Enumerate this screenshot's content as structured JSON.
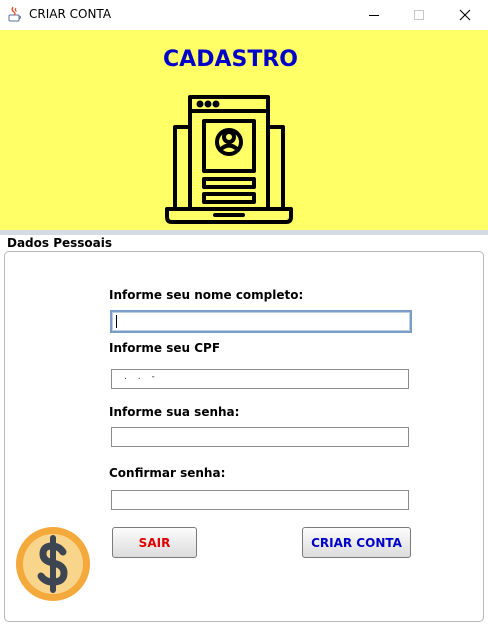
{
  "window": {
    "title": "CRIAR CONTA",
    "icons": [
      "java-cup-icon",
      "minimize-icon",
      "maximize-icon",
      "close-icon"
    ]
  },
  "banner": {
    "title": "CADASTRO",
    "icon": "laptop-user-profile-icon",
    "background": "#ffff66",
    "title_color": "#0000c8"
  },
  "section": {
    "label": "Dados Pessoais"
  },
  "form": {
    "name_label": "Informe seu nome completo:",
    "name_value": "",
    "cpf_label": "Informe seu CPF",
    "cpf_value": ". . -",
    "password_label": "Informe sua senha:",
    "password_value": "",
    "confirm_label": "Confirmar senha:",
    "confirm_value": ""
  },
  "buttons": {
    "exit_label": "SAIR",
    "exit_color": "#e00000",
    "create_label": "CRIAR CONTA",
    "create_color": "#0000c8"
  },
  "decor": {
    "coin_icon": "dollar-coin-icon"
  }
}
